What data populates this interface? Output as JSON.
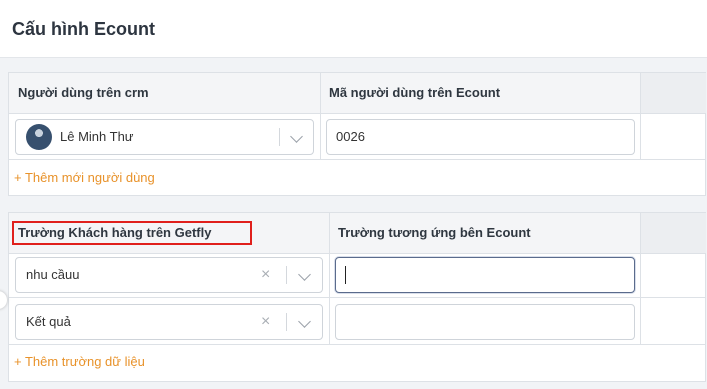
{
  "page": {
    "title": "Cấu hình Ecount"
  },
  "users": {
    "col_crm": "Người dùng trên crm",
    "col_ecount": "Mã người dùng trên Ecount",
    "rows": [
      {
        "crm_user": "Lê Minh Thư",
        "ecount_code": "0026"
      }
    ],
    "add_label": "+ Thêm mới người dùng"
  },
  "fields": {
    "col_getfly": "Trường Khách hàng trên Getfly",
    "col_ecount": "Trường tương ứng bên Ecount",
    "rows": [
      {
        "getfly_field": "nhu cầuu",
        "ecount_field": ""
      },
      {
        "getfly_field": "Kết quả",
        "ecount_field": ""
      }
    ],
    "add_label": "+ Thêm trường dữ liệu"
  },
  "colors": {
    "accent": "#e8922a",
    "highlight": "#e0201c"
  }
}
